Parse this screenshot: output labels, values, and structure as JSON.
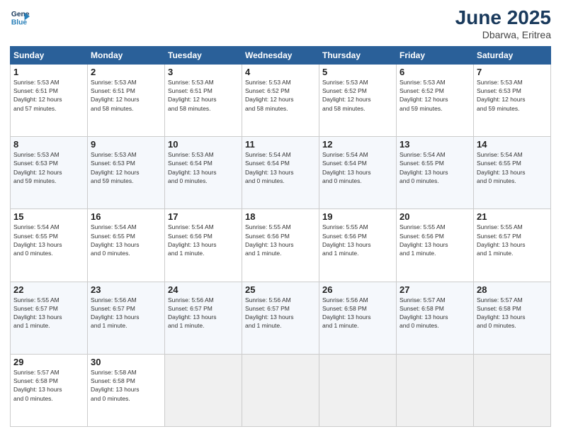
{
  "header": {
    "logo_line1": "General",
    "logo_line2": "Blue",
    "title": "June 2025",
    "subtitle": "Dbarwa, Eritrea"
  },
  "weekdays": [
    "Sunday",
    "Monday",
    "Tuesday",
    "Wednesday",
    "Thursday",
    "Friday",
    "Saturday"
  ],
  "weeks": [
    [
      {
        "day": "1",
        "info": "Sunrise: 5:53 AM\nSunset: 6:51 PM\nDaylight: 12 hours\nand 57 minutes."
      },
      {
        "day": "2",
        "info": "Sunrise: 5:53 AM\nSunset: 6:51 PM\nDaylight: 12 hours\nand 58 minutes."
      },
      {
        "day": "3",
        "info": "Sunrise: 5:53 AM\nSunset: 6:51 PM\nDaylight: 12 hours\nand 58 minutes."
      },
      {
        "day": "4",
        "info": "Sunrise: 5:53 AM\nSunset: 6:52 PM\nDaylight: 12 hours\nand 58 minutes."
      },
      {
        "day": "5",
        "info": "Sunrise: 5:53 AM\nSunset: 6:52 PM\nDaylight: 12 hours\nand 58 minutes."
      },
      {
        "day": "6",
        "info": "Sunrise: 5:53 AM\nSunset: 6:52 PM\nDaylight: 12 hours\nand 59 minutes."
      },
      {
        "day": "7",
        "info": "Sunrise: 5:53 AM\nSunset: 6:53 PM\nDaylight: 12 hours\nand 59 minutes."
      }
    ],
    [
      {
        "day": "8",
        "info": "Sunrise: 5:53 AM\nSunset: 6:53 PM\nDaylight: 12 hours\nand 59 minutes."
      },
      {
        "day": "9",
        "info": "Sunrise: 5:53 AM\nSunset: 6:53 PM\nDaylight: 12 hours\nand 59 minutes."
      },
      {
        "day": "10",
        "info": "Sunrise: 5:53 AM\nSunset: 6:54 PM\nDaylight: 13 hours\nand 0 minutes."
      },
      {
        "day": "11",
        "info": "Sunrise: 5:54 AM\nSunset: 6:54 PM\nDaylight: 13 hours\nand 0 minutes."
      },
      {
        "day": "12",
        "info": "Sunrise: 5:54 AM\nSunset: 6:54 PM\nDaylight: 13 hours\nand 0 minutes."
      },
      {
        "day": "13",
        "info": "Sunrise: 5:54 AM\nSunset: 6:55 PM\nDaylight: 13 hours\nand 0 minutes."
      },
      {
        "day": "14",
        "info": "Sunrise: 5:54 AM\nSunset: 6:55 PM\nDaylight: 13 hours\nand 0 minutes."
      }
    ],
    [
      {
        "day": "15",
        "info": "Sunrise: 5:54 AM\nSunset: 6:55 PM\nDaylight: 13 hours\nand 0 minutes."
      },
      {
        "day": "16",
        "info": "Sunrise: 5:54 AM\nSunset: 6:55 PM\nDaylight: 13 hours\nand 0 minutes."
      },
      {
        "day": "17",
        "info": "Sunrise: 5:54 AM\nSunset: 6:56 PM\nDaylight: 13 hours\nand 1 minute."
      },
      {
        "day": "18",
        "info": "Sunrise: 5:55 AM\nSunset: 6:56 PM\nDaylight: 13 hours\nand 1 minute."
      },
      {
        "day": "19",
        "info": "Sunrise: 5:55 AM\nSunset: 6:56 PM\nDaylight: 13 hours\nand 1 minute."
      },
      {
        "day": "20",
        "info": "Sunrise: 5:55 AM\nSunset: 6:56 PM\nDaylight: 13 hours\nand 1 minute."
      },
      {
        "day": "21",
        "info": "Sunrise: 5:55 AM\nSunset: 6:57 PM\nDaylight: 13 hours\nand 1 minute."
      }
    ],
    [
      {
        "day": "22",
        "info": "Sunrise: 5:55 AM\nSunset: 6:57 PM\nDaylight: 13 hours\nand 1 minute."
      },
      {
        "day": "23",
        "info": "Sunrise: 5:56 AM\nSunset: 6:57 PM\nDaylight: 13 hours\nand 1 minute."
      },
      {
        "day": "24",
        "info": "Sunrise: 5:56 AM\nSunset: 6:57 PM\nDaylight: 13 hours\nand 1 minute."
      },
      {
        "day": "25",
        "info": "Sunrise: 5:56 AM\nSunset: 6:57 PM\nDaylight: 13 hours\nand 1 minute."
      },
      {
        "day": "26",
        "info": "Sunrise: 5:56 AM\nSunset: 6:58 PM\nDaylight: 13 hours\nand 1 minute."
      },
      {
        "day": "27",
        "info": "Sunrise: 5:57 AM\nSunset: 6:58 PM\nDaylight: 13 hours\nand 0 minutes."
      },
      {
        "day": "28",
        "info": "Sunrise: 5:57 AM\nSunset: 6:58 PM\nDaylight: 13 hours\nand 0 minutes."
      }
    ],
    [
      {
        "day": "29",
        "info": "Sunrise: 5:57 AM\nSunset: 6:58 PM\nDaylight: 13 hours\nand 0 minutes."
      },
      {
        "day": "30",
        "info": "Sunrise: 5:58 AM\nSunset: 6:58 PM\nDaylight: 13 hours\nand 0 minutes."
      },
      {
        "day": "",
        "info": ""
      },
      {
        "day": "",
        "info": ""
      },
      {
        "day": "",
        "info": ""
      },
      {
        "day": "",
        "info": ""
      },
      {
        "day": "",
        "info": ""
      }
    ]
  ]
}
